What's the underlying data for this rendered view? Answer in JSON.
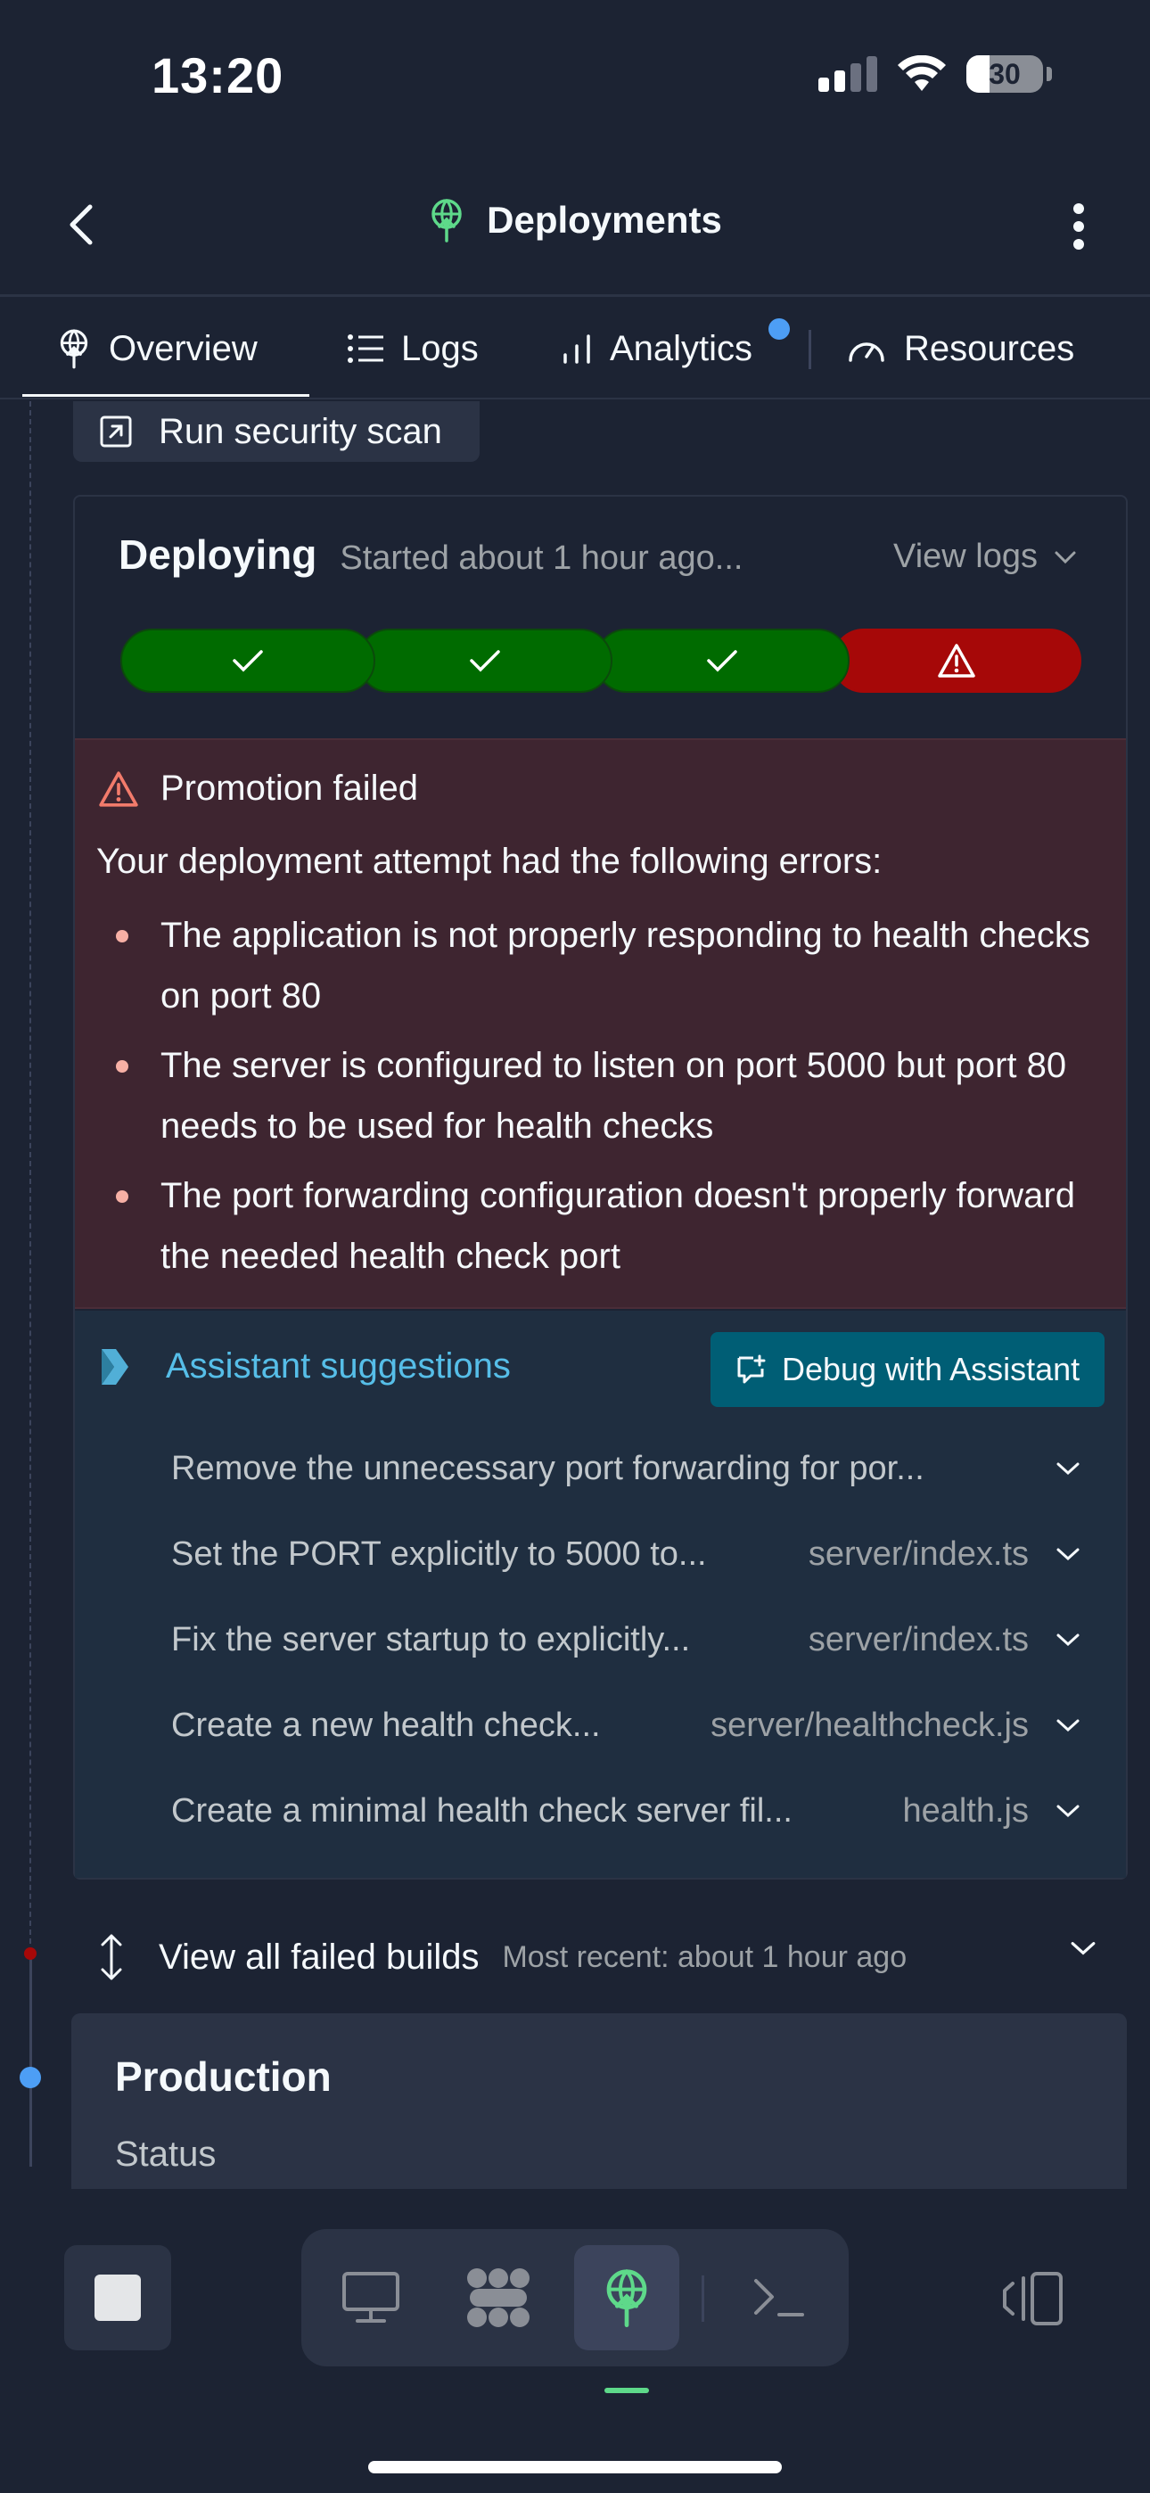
{
  "status_bar": {
    "time": "13:20",
    "battery": "30",
    "icons": [
      "signal-icon",
      "wifi-icon",
      "battery-icon"
    ]
  },
  "header": {
    "title": "Deployments",
    "icon": "deploy-antenna-icon",
    "back_icon": "chevron-left-icon",
    "menu_icon": "kebab-menu-icon"
  },
  "tabs": [
    {
      "label": "Overview",
      "icon": "deploy-antenna-icon",
      "active": true
    },
    {
      "label": "Logs",
      "icon": "list-icon",
      "active": false
    },
    {
      "label": "Analytics",
      "icon": "bar-chart-icon",
      "active": false,
      "notification": true
    },
    {
      "label": "Resources",
      "icon": "gauge-icon",
      "active": false
    }
  ],
  "security_scan": {
    "label": "Run security scan",
    "icon": "external-link-icon"
  },
  "deploy": {
    "title": "Deploying",
    "subtitle": "Started about 1 hour ago...",
    "view_logs": "View logs",
    "steps": [
      "success",
      "success",
      "success",
      "failed"
    ]
  },
  "error": {
    "title": "Promotion failed",
    "intro": "Your deployment attempt had the following errors:",
    "items": [
      "The application is not properly responding to health checks on port 80",
      "The server is configured to listen on port 5000 but port 80 needs to be used for health checks",
      "The port forwarding configuration doesn't properly forward the needed health check port"
    ]
  },
  "assistant": {
    "title": "Assistant suggestions",
    "debug_button": "Debug with Assistant",
    "suggestions": [
      {
        "text": "Remove the unnecessary port forwarding for por...",
        "file": ""
      },
      {
        "text": "Set the PORT explicitly to 5000 to...",
        "file": "server/index.ts"
      },
      {
        "text": "Fix the server startup to explicitly...",
        "file": "server/index.ts"
      },
      {
        "text": "Create a new health check...",
        "file": "server/healthcheck.js"
      },
      {
        "text": "Create a minimal health check server fil...",
        "file": "health.js"
      }
    ]
  },
  "failed_builds": {
    "label": "View all failed builds",
    "recent": "Most recent: about 1 hour ago"
  },
  "production": {
    "title": "Production",
    "status_label": "Status"
  },
  "colors": {
    "background": "#1c2333",
    "surface": "#2b3345",
    "success": "#006b00",
    "danger": "#a60808",
    "error_bg": "#3e2530",
    "assistant_bg": "#1f2e40",
    "accent_blue": "#4d9ef5",
    "assistant_cyan": "#56bee8",
    "debug_button": "#005e75",
    "deploy_green": "#5ed98a"
  }
}
